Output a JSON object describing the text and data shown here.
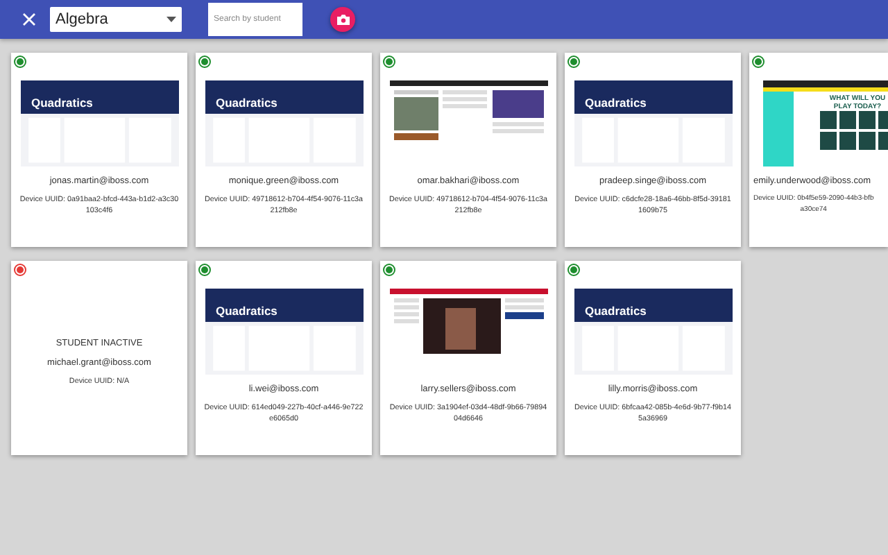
{
  "toolbar": {
    "class_select": {
      "value": "Algebra"
    },
    "search": {
      "placeholder": "Search by student"
    }
  },
  "cards": [
    {
      "active": true,
      "thumbnail": {
        "kind": "lesson",
        "heading": "Quadratics"
      },
      "email": "jonas.martin@iboss.com",
      "uuid_lines": [
        "Device UUID: 0a91baa2-bfcd-443a-b1d2-a3c30",
        "103c4f6"
      ]
    },
    {
      "active": true,
      "thumbnail": {
        "kind": "lesson",
        "heading": "Quadratics"
      },
      "email": "monique.green@iboss.com",
      "uuid_lines": [
        "Device UUID: 49718612-b704-4f54-9076-11c3a",
        "212fb8e"
      ]
    },
    {
      "active": true,
      "thumbnail": {
        "kind": "news"
      },
      "email": "omar.bakhari@iboss.com",
      "uuid_lines": [
        "Device UUID: 49718612-b704-4f54-9076-11c3a",
        "212fb8e"
      ]
    },
    {
      "active": true,
      "thumbnail": {
        "kind": "lesson",
        "heading": "Quadratics"
      },
      "email": "pradeep.singe@iboss.com",
      "uuid_lines": [
        "Device UUID: c6dcfe28-18a6-46bb-8f5d-39181",
        "1609b75"
      ]
    },
    {
      "active": true,
      "thumbnail": {
        "kind": "game",
        "heading": "WHAT WILL YOU PLAY TODAY?"
      },
      "email": "emily.underwood@iboss.com",
      "uuid_lines": [
        "Device UUID: 0b4f5e59-2090-44b3-bfb",
        "a30ce74"
      ]
    },
    {
      "active": false,
      "status": "STUDENT INACTIVE",
      "email": "michael.grant@iboss.com",
      "uuid_lines": [
        "Device UUID: N/A"
      ]
    },
    {
      "active": true,
      "thumbnail": {
        "kind": "lesson",
        "heading": "Quadratics"
      },
      "email": "li.wei@iboss.com",
      "uuid_lines": [
        "Device UUID: 614ed049-227b-40cf-a446-9e722",
        "e6065d0"
      ]
    },
    {
      "active": true,
      "thumbnail": {
        "kind": "video"
      },
      "email": "larry.sellers@iboss.com",
      "uuid_lines": [
        "Device UUID: 3a1904ef-03d4-48df-9b66-79894",
        "04d6646"
      ]
    },
    {
      "active": true,
      "thumbnail": {
        "kind": "lesson",
        "heading": "Quadratics"
      },
      "email": "lilly.morris@iboss.com",
      "uuid_lines": [
        "Device UUID: 6bfcaa42-085b-4e6d-9b77-f9b14",
        "5a36969"
      ]
    }
  ]
}
